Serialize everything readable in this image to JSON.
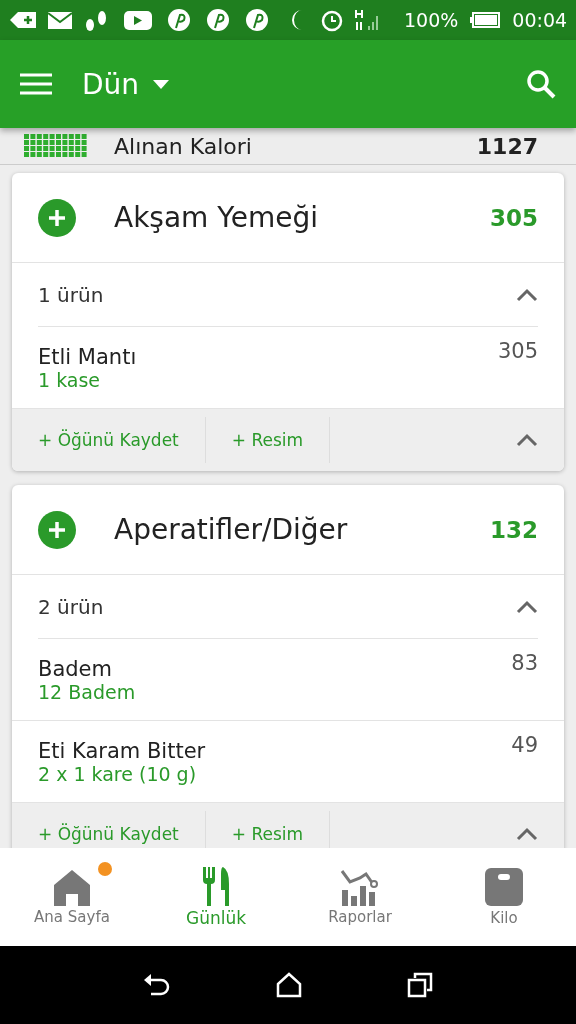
{
  "status_bar": {
    "battery": "100%",
    "time": "00:04"
  },
  "app_bar": {
    "title": "Dün"
  },
  "summary": {
    "label": "Alınan Kalori",
    "value": "1127"
  },
  "meals": [
    {
      "title": "Akşam Yemeği",
      "calories": "305",
      "count_label": "1 ürün",
      "expanded": true,
      "items": [
        {
          "name": "Etli Mantı",
          "amount": "1  kase",
          "calories": "305"
        }
      ],
      "actions": [
        "+ Öğünü Kaydet",
        "+ Resim"
      ]
    },
    {
      "title": "Aperatifler/Diğer",
      "calories": "132",
      "count_label": "2 ürün",
      "expanded": true,
      "items": [
        {
          "name": "Badem",
          "amount": "12  Badem",
          "calories": "83"
        },
        {
          "name": "Eti Karam Bitter",
          "amount": "2  x 1 kare (10 g)",
          "calories": "49"
        }
      ],
      "actions": [
        "+ Öğünü Kaydet",
        "+ Resim"
      ]
    }
  ],
  "bottom_nav": [
    {
      "kind": "home",
      "label": "Ana Sayfa",
      "selected": false,
      "notification": true
    },
    {
      "kind": "diary",
      "label": "Günlük",
      "selected": true,
      "notification": false
    },
    {
      "kind": "reports",
      "label": "Raporlar",
      "selected": false,
      "notification": false
    },
    {
      "kind": "weight",
      "label": "Kilo",
      "selected": false,
      "notification": false
    }
  ]
}
